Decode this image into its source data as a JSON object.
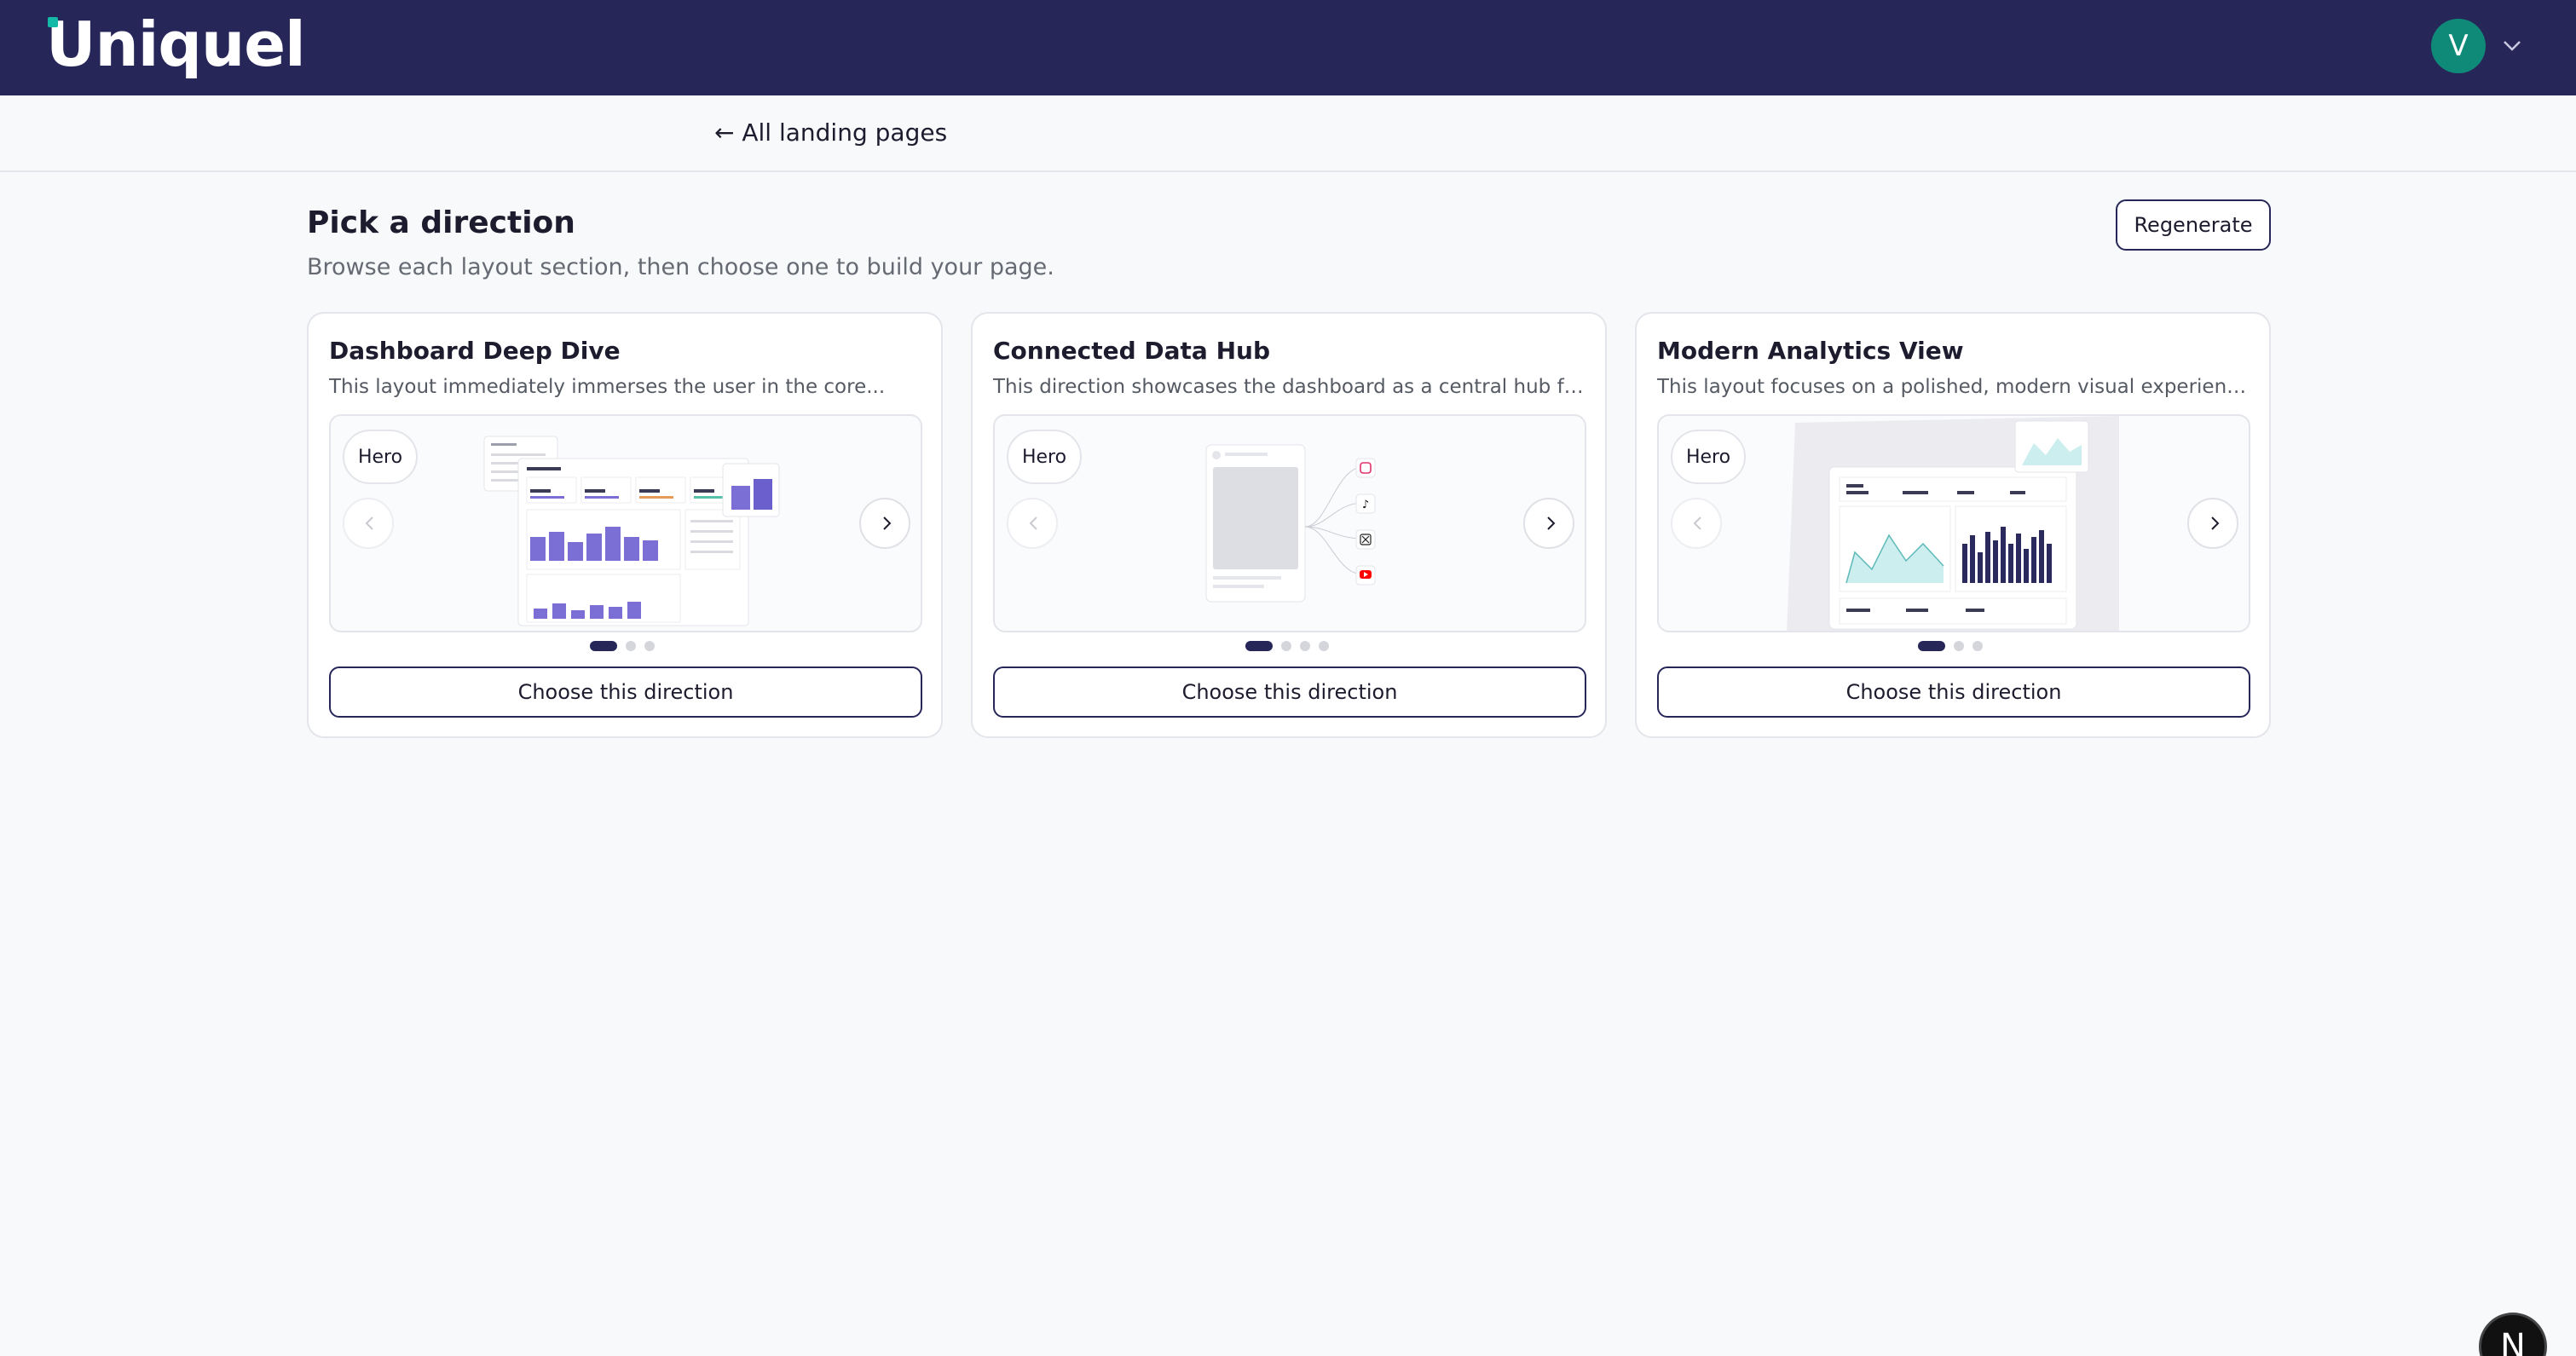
{
  "header": {
    "logo_text": "Uniquel",
    "user_initial": "V"
  },
  "subnav": {
    "back_label": "← All landing pages"
  },
  "main": {
    "title": "Pick a direction",
    "subtitle": "Browse each layout section, then choose one to build your page.",
    "regenerate_label": "Regenerate"
  },
  "cards": [
    {
      "title": "Dashboard Deep Dive",
      "description": "This layout immediately immerses the user in the core...",
      "section_label": "Hero",
      "choose_label": "Choose this direction",
      "slide_count": 3,
      "active_slide": 1
    },
    {
      "title": "Connected Data Hub",
      "description": "This direction showcases the dashboard as a central hub for...",
      "section_label": "Hero",
      "choose_label": "Choose this direction",
      "slide_count": 4,
      "active_slide": 1
    },
    {
      "title": "Modern Analytics View",
      "description": "This layout focuses on a polished, modern visual experience o...",
      "section_label": "Hero",
      "choose_label": "Choose this direction",
      "slide_count": 3,
      "active_slide": 1
    }
  ],
  "dev_badge": {
    "letter": "N"
  },
  "colors": {
    "header_bg": "#262659",
    "accent": "#14b8a6",
    "avatar_bg": "#0f8a78",
    "button_border": "#262659",
    "bar_purple": "#7b6fd6",
    "bar_navy": "#2b2a5e"
  }
}
